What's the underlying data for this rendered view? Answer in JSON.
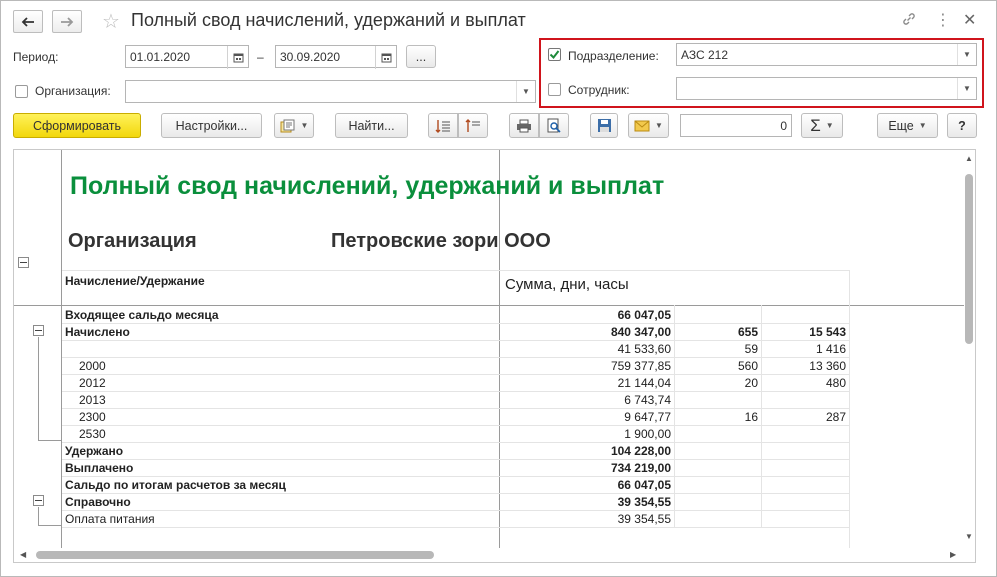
{
  "window": {
    "title": "Полный свод начислений, удержаний и выплат"
  },
  "filters": {
    "period_label": "Период:",
    "date_from": "01.01.2020",
    "date_sep": "–",
    "date_to": "30.09.2020",
    "more_button": "...",
    "organization_label": "Организация:",
    "organization_value": "",
    "department_label": "Подразделение:",
    "department_checked": true,
    "department_value": "АЗС 212",
    "employee_label": "Сотрудник:",
    "employee_checked": false,
    "employee_value": ""
  },
  "toolbar": {
    "generate": "Сформировать",
    "settings": "Настройки...",
    "find": "Найти...",
    "sum_value": "0",
    "sigma": "Σ",
    "more": "Еще",
    "help": "?"
  },
  "report": {
    "title": "Полный свод начислений, удержаний и выплат",
    "org_label": "Организация",
    "org_value": "Петровские зори ООО",
    "col_header_1": "Начисление/Удержание",
    "col_header_2": "Сумма, дни, часы",
    "rows": [
      {
        "label": "Входящее сальдо месяца",
        "sum": "66 047,05",
        "days": "",
        "hours": "",
        "bold": true
      },
      {
        "label": "Начислено",
        "sum": "840 347,00",
        "days": "655",
        "hours": "15 543",
        "bold": true
      },
      {
        "label": "",
        "sum": "41 533,60",
        "days": "59",
        "hours": "1 416",
        "bold": false
      },
      {
        "label": "2000",
        "sum": "759 377,85",
        "days": "560",
        "hours": "13 360",
        "bold": false
      },
      {
        "label": "2012",
        "sum": "21 144,04",
        "days": "20",
        "hours": "480",
        "bold": false
      },
      {
        "label": "2013",
        "sum": "6 743,74",
        "days": "",
        "hours": "",
        "bold": false
      },
      {
        "label": "2300",
        "sum": "9 647,77",
        "days": "16",
        "hours": "287",
        "bold": false
      },
      {
        "label": "2530",
        "sum": "1 900,00",
        "days": "",
        "hours": "",
        "bold": false
      },
      {
        "label": "Удержано",
        "sum": "104 228,00",
        "days": "",
        "hours": "",
        "bold": true
      },
      {
        "label": "Выплачено",
        "sum": "734 219,00",
        "days": "",
        "hours": "",
        "bold": true
      },
      {
        "label": "Сальдо по итогам расчетов за месяц",
        "sum": "66 047,05",
        "days": "",
        "hours": "",
        "bold": true
      },
      {
        "label": "Справочно",
        "sum": "39 354,55",
        "days": "",
        "hours": "",
        "bold": true
      },
      {
        "label": "Оплата питания",
        "sum": "39 354,55",
        "days": "",
        "hours": "",
        "bold": false
      }
    ]
  }
}
